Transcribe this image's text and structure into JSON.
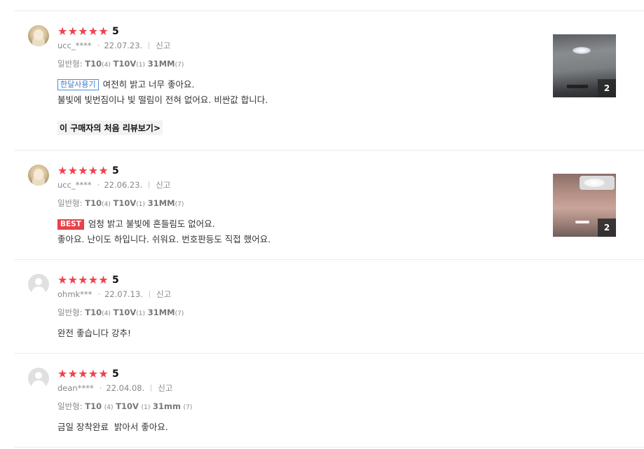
{
  "reviews": [
    {
      "score": "5",
      "user": "ucc_****",
      "date": "22.07.23.",
      "report": "신고",
      "option": {
        "label": "일반형:",
        "a": "T10",
        "a_qty": "(4)",
        "b": "T10V",
        "b_qty": "(1)",
        "c": "31MM",
        "c_qty": "(7)"
      },
      "badge": "한달사용기",
      "lines": [
        "여전히 밝고 너무 좋아요.",
        "불빛에 빛번짐이나 빛 떨림이 전혀 없어요. 비싼값 합니다."
      ],
      "first_review_link": "이 구매자의 처음 리뷰보기",
      "photo_count": "2"
    },
    {
      "score": "5",
      "user": "ucc_****",
      "date": "22.06.23.",
      "report": "신고",
      "option": {
        "label": "일반형:",
        "a": "T10",
        "a_qty": "(4)",
        "b": "T10V",
        "b_qty": "(1)",
        "c": "31MM",
        "c_qty": "(7)"
      },
      "badge": "BEST",
      "lines": [
        "엄청 밝고 불빛에 흔들림도 없어요.",
        "좋아요. 난이도 하입니다. 쉬워요. 번호판등도 직접 했어요."
      ],
      "photo_count": "2"
    },
    {
      "score": "5",
      "user": "ohmk***",
      "date": "22.07.13.",
      "report": "신고",
      "option": {
        "label": "일반형:",
        "a": "T10",
        "a_qty": "(4)",
        "b": "T10V",
        "b_qty": "(1)",
        "c": "31MM",
        "c_qty": "(7)"
      },
      "lines": [
        "완전 좋습니다 강추!"
      ]
    },
    {
      "score": "5",
      "user": "dean****",
      "date": "22.04.08.",
      "report": "신고",
      "option": {
        "label": "일반형:",
        "a": "T10",
        "a_qty": "(4)",
        "b": "T10V",
        "b_qty": "(1)",
        "c": "31mm",
        "c_qty": "(7)"
      },
      "lines": [
        "금일 장착완료  밝아서 좋아요."
      ]
    }
  ],
  "colors": {
    "star": "#f0424d",
    "best_badge": "#e8424a",
    "month_badge": "#4a8fd8"
  },
  "icons": {
    "star": "star-icon",
    "chevron": "chevron-right-icon",
    "avatar_default": "default-user-icon"
  }
}
